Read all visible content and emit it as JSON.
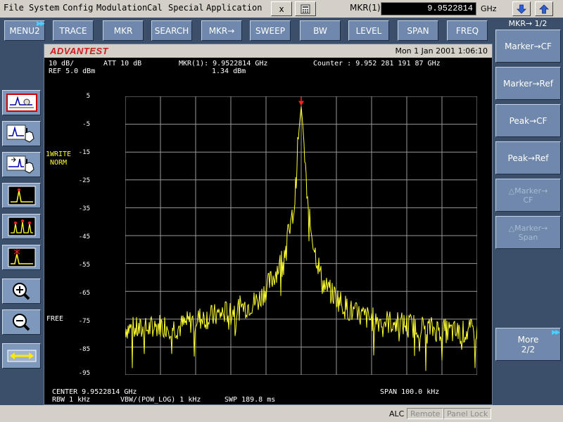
{
  "menu": [
    "File",
    "System",
    "Config",
    "Modulation",
    "Cal",
    "Special",
    "Application"
  ],
  "toolbar": {
    "close_label": "x",
    "mkr_label": "MKR(1):",
    "mkr_value": "9.9522814",
    "mkr_unit": "GHz"
  },
  "softkeys": [
    "MENU2",
    "TRACE",
    "MKR",
    "SEARCH",
    "MKR→",
    "SWEEP",
    "BW",
    "LEVEL",
    "SPAN",
    "FREQ"
  ],
  "panel": {
    "title": "MKR→  1/2",
    "buttons": [
      "Marker→CF",
      "Marker→Ref",
      "Peak→CF",
      "Peak→Ref"
    ],
    "disabled": [
      {
        "line1": "△Marker→",
        "line2": "CF"
      },
      {
        "line1": "△Marker→",
        "line2": "Span"
      }
    ],
    "more_line1": "More",
    "more_line2": "2/2"
  },
  "header": {
    "brand": "ADVANTEST",
    "datetime": "Mon 1 Jan 2001 1:06:10"
  },
  "info": {
    "scale": "10 dB/",
    "ref": "REF 5.0 dBm",
    "att": "ATT 10 dB",
    "mkr": "MKR(1): 9.9522814 GHz",
    "mkr_level": "1.34 dBm",
    "counter": "Counter : 9.952 281 191 87 GHz",
    "write1": "1WRITE",
    "write2": "NORM",
    "free": "FREE",
    "center": "CENTER 9.9522814 GHz",
    "span": "SPAN 100.0 kHz",
    "rbw": "RBW 1 kHz",
    "vbw": "VBW/(POW_LOG) 1 kHz",
    "swp": "SWP 189.8 ms"
  },
  "status": [
    "ALC",
    "Remote",
    "Panel Lock"
  ],
  "colors": {
    "trace": "#ffff33",
    "grid": "#9a9a9a",
    "marker": "#ff2020",
    "softkey": "#6f88ab",
    "panel_bg": "#3b4f6a",
    "brand": "#cc1f1f"
  },
  "icons": [
    "peak-search-icon",
    "peak-hand-icon",
    "next-peak-hand-icon",
    "single-peak-icon",
    "multi-peak-icon",
    "marker-peak-icon",
    "zoom-in-icon",
    "zoom-out-icon",
    "span-expand-icon"
  ],
  "chart_data": {
    "type": "line",
    "xlabel": "",
    "ylabel": "",
    "x_range_kHz": [
      -50,
      50
    ],
    "ylim": [
      -95,
      5
    ],
    "y_ticks": [
      5,
      -5,
      -15,
      -25,
      -35,
      -45,
      -55,
      -65,
      -75,
      -85,
      -95
    ],
    "grid": true,
    "marker": {
      "name": "MKR(1)",
      "x_kHz": 0,
      "y": 1.34
    },
    "series": [
      {
        "x_kHz": [
          -50,
          -45,
          -40,
          -35,
          -30,
          -25,
          -20,
          -15,
          -12,
          -10,
          -8,
          -6,
          -5,
          -4,
          -3,
          -2,
          -1.5,
          -1,
          -0.5,
          0,
          0.5,
          1,
          1.5,
          2,
          3,
          4,
          5,
          6,
          8,
          10,
          12,
          15,
          20,
          25,
          30,
          35,
          40,
          45,
          50
        ],
        "y": [
          -78,
          -79,
          -77,
          -78,
          -75,
          -74,
          -72,
          -70,
          -68,
          -64,
          -60,
          -55,
          -52,
          -46,
          -42,
          -35,
          -26,
          -14,
          -5,
          1.34,
          -6,
          -16,
          -28,
          -37,
          -44,
          -51,
          -56,
          -62,
          -65,
          -67,
          -70,
          -73,
          -75,
          -76,
          -77,
          -78,
          -79,
          -80,
          -79
        ]
      }
    ]
  }
}
